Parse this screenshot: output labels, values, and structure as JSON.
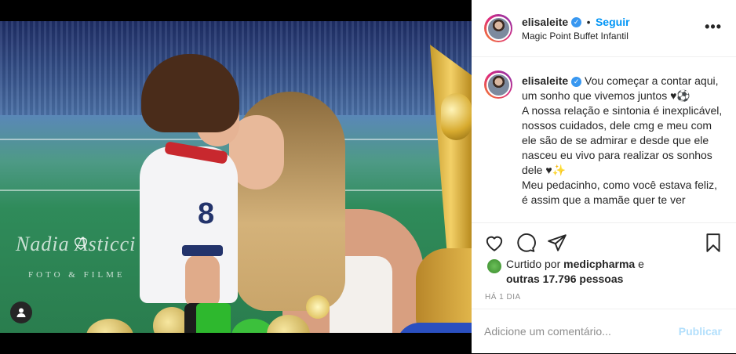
{
  "post": {
    "username": "elisaleite",
    "verified_badge": "✓",
    "follow_label": "Seguir",
    "location": "Magic Point Buffet Infantil",
    "more_icon": "more-icon",
    "caption": "Vou começar a contar aqui, um sonho que vivemos juntos ♥⚽\nA nossa relação e sintonia é inexplicável, nossos cuidados, dele cmg e meu com ele são de se admirar e desde que ele nasceu eu vivo para realizar os sonhos dele ♥✨\nMeu pedacinho, como você estava feliz, é assim que a mamãe quer te ver",
    "liked_by_prefix": "Curtido por",
    "liked_by_user": "medicpharma",
    "liked_by_and": "e",
    "liked_by_others": "outras 17.796 pessoas",
    "timestamp": "HÁ 1 DIA",
    "comment_placeholder": "Adicione um comentário...",
    "publish_label": "Publicar"
  },
  "photo": {
    "watermark_title": "Nadia Asticci",
    "watermark_subtitle": "FOTO & FILME",
    "shirt_number": "8"
  },
  "colors": {
    "link_blue": "#0095f6",
    "publish_disabled": "#b2dffc",
    "verified_blue": "#3897f0"
  }
}
